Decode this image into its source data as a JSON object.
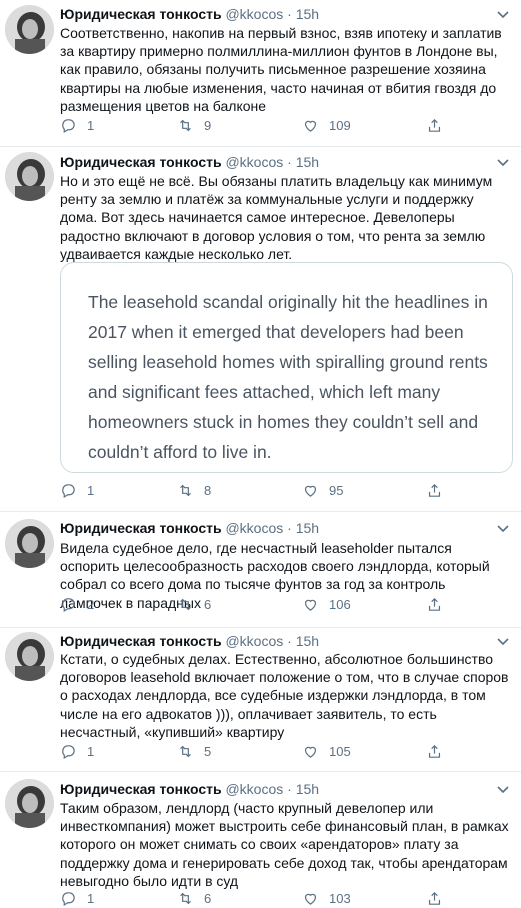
{
  "tweets": [
    {
      "name": "Юридическая тонкость",
      "handle": "@kkocos",
      "time": "· 15h",
      "text": "Соответственно, накопив на первый взнос, взяв ипотеку и заплатив за квартиру примерно полмиллина-миллион фунтов в Лондоне вы, как правило, обязаны получить письменное разрешение хозяина квартиры на любые изменения, часто начиная от вбития гвоздя до размещения цветов на балконе",
      "replies": "1",
      "retweets": "9",
      "likes": "109"
    },
    {
      "name": "Юридическая тонкость",
      "handle": "@kkocos",
      "time": "· 15h",
      "text": "Но и это ещё не всё. Вы обязаны платить владельцу как минимум ренту за землю и платёж за коммунальные услуги и поддержку дома. Вот здесь начинается самое интересное. Девелоперы радостно включают в договор условия о том, что рента за землю удваивается каждые несколько лет.",
      "quote": "The leasehold scandal originally hit the headlines in 2017 when it emerged that developers had been selling leasehold homes with spiralling ground rents and significant fees attached, which left many homeowners stuck in homes they couldn’t sell and couldn’t afford to live in.",
      "replies": "1",
      "retweets": "8",
      "likes": "95"
    },
    {
      "name": "Юридическая тонкость",
      "handle": "@kkocos",
      "time": "· 15h",
      "text": "Видела судебное дело, где несчастный leaseholder пытался оспорить целесообразность расходов своего лэндлорда, который собрал со всего дома по тысяче фунтов за год за контроль лампочек в парадных",
      "replies": "2",
      "retweets": "6",
      "likes": "106"
    },
    {
      "name": "Юридическая тонкость",
      "handle": "@kkocos",
      "time": "· 15h",
      "text": "Кстати, о судебных делах. Естественно, абсолютное большинство договоров leasehold включает положение о том, что в случае споров о расходах лендлорда, все судебные издержки лэндлорда, в том числе на его адвокатов ))), оплачивает заявитель, то есть несчастный, «купивший» квартиру",
      "replies": "1",
      "retweets": "5",
      "likes": "105"
    },
    {
      "name": "Юридическая тонкость",
      "handle": "@kkocos",
      "time": "· 15h",
      "text": "Таким образом, лендлорд (часто крупный девелопер или инвесткомпания) может выстроить себе финансовый план, в рамках которого он может снимать со своих «арендаторов» плату за поддержку дома и генерировать себе доход так, чтобы арендаторам невыгодно было идти в суд",
      "replies": "1",
      "retweets": "6",
      "likes": "103"
    }
  ],
  "colors": {
    "text": "#0f1419",
    "muted": "#5b7083",
    "border": "#cfd9de",
    "divider": "#e6ecf0"
  },
  "icons": [
    "reply-icon",
    "retweet-icon",
    "like-icon",
    "share-icon",
    "chevron-down-icon"
  ]
}
